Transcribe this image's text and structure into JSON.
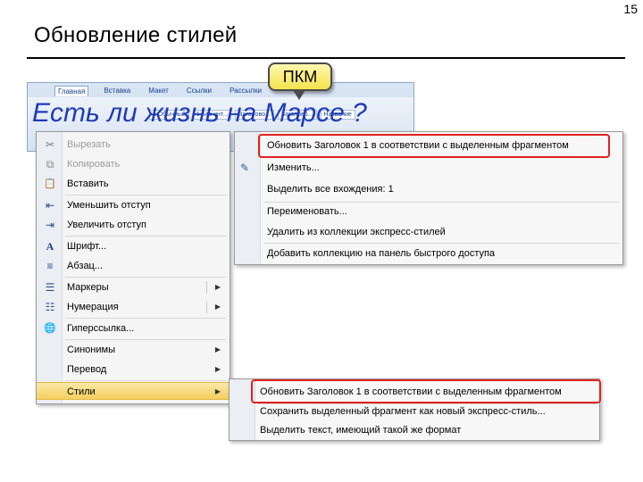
{
  "page": {
    "number": "15",
    "title": "Обновление стилей"
  },
  "ribbon": {
    "tabs": [
      "Главная",
      "Вставка",
      "Макет",
      "Ссылки",
      "Рассылки"
    ],
    "styles": [
      "1 Обычный",
      "1 Без инт...",
      "Заголово...",
      "Заголово...",
      "Название"
    ]
  },
  "overlay_heading": "Есть ли жизнь на Марсе ?",
  "callout": {
    "text": "ПКМ"
  },
  "context_menu": {
    "items": [
      {
        "label": "Вырезать",
        "icon": "scissors-icon",
        "glyph": "✂",
        "disabled": true
      },
      {
        "label": "Копировать",
        "icon": "copy-icon",
        "glyph": "⧉",
        "disabled": true
      },
      {
        "label": "Вставить",
        "icon": "paste-icon",
        "glyph": "📋",
        "disabled": false
      },
      {
        "label": "Уменьшить отступ",
        "icon": "decrease-indent-icon",
        "glyph": "⇤",
        "disabled": false
      },
      {
        "label": "Увеличить отступ",
        "icon": "increase-indent-icon",
        "glyph": "⇥",
        "disabled": false
      },
      {
        "label": "Шрифт...",
        "icon": "font-icon",
        "glyph": "A",
        "disabled": false
      },
      {
        "label": "Абзац...",
        "icon": "paragraph-icon",
        "glyph": "≡",
        "disabled": false
      },
      {
        "label": "Маркеры",
        "icon": "bullets-icon",
        "glyph": "☰",
        "disabled": false,
        "submenu": true
      },
      {
        "label": "Нумерация",
        "icon": "numbering-icon",
        "glyph": "☷",
        "disabled": false,
        "submenu": true
      },
      {
        "label": "Гиперссылка...",
        "icon": "hyperlink-icon",
        "glyph": "🌐",
        "disabled": false
      },
      {
        "label": "Синонимы",
        "disabled": false,
        "submenu": true
      },
      {
        "label": "Перевод",
        "disabled": false,
        "submenu": true
      },
      {
        "label": "Стили",
        "disabled": false,
        "submenu": true,
        "highlighted": true
      }
    ],
    "arrow": "▶"
  },
  "submenu_top": {
    "items": [
      {
        "label": "Обновить Заголовок 1 в соответствии с выделенным фрагментом",
        "framed": true
      },
      {
        "label": "Изменить...",
        "icon": "modify-style-icon",
        "glyph": "✎"
      },
      {
        "label": "Выделить все вхождения: 1"
      },
      {
        "label": "Переименовать..."
      },
      {
        "label": "Удалить из коллекции экспресс-стилей"
      },
      {
        "label": "Добавить коллекцию на панель быстрого доступа"
      }
    ]
  },
  "submenu_bottom": {
    "items": [
      {
        "label": "Обновить Заголовок 1 в соответствии с выделенным фрагментом",
        "framed": true
      },
      {
        "label": "Сохранить выделенный фрагмент как новый экспресс-стиль..."
      },
      {
        "label": "Выделить текст, имеющий такой же формат"
      }
    ]
  },
  "colors": {
    "highlight_frame": "#e02020",
    "heading_blue": "#1f3bb8",
    "callout_fill": "#f3e24c"
  }
}
